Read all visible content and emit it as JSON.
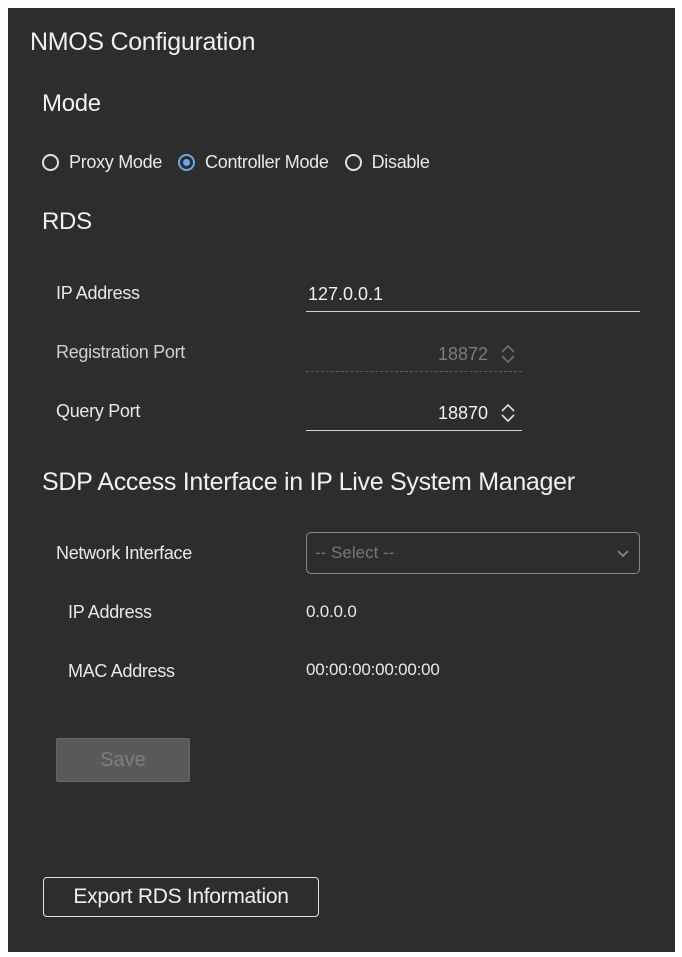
{
  "panel": {
    "title": "NMOS Configuration"
  },
  "mode": {
    "heading": "Mode",
    "options": [
      {
        "label": "Proxy Mode",
        "checked": false
      },
      {
        "label": "Controller Mode",
        "checked": true
      },
      {
        "label": "Disable",
        "checked": false
      }
    ]
  },
  "rds": {
    "heading": "RDS",
    "ip_address_label": "IP Address",
    "ip_address_value": "127.0.0.1",
    "registration_port_label": "Registration Port",
    "registration_port_value": "18872",
    "registration_port_disabled": true,
    "query_port_label": "Query Port",
    "query_port_value": "18870"
  },
  "sdp": {
    "heading": "SDP Access Interface in IP Live System Manager",
    "network_interface_label": "Network Interface",
    "network_interface_value": "-- Select --",
    "ip_address_label": "IP Address",
    "ip_address_value": "0.0.0.0",
    "mac_address_label": "MAC Address",
    "mac_address_value": "00:00:00:00:00:00"
  },
  "buttons": {
    "save_label": "Save",
    "save_disabled": true,
    "export_label": "Export RDS Information"
  },
  "icons": {
    "spin": "up-down-spinner-icon",
    "dropdown": "chevron-down-icon",
    "radio": "radio-button-icon"
  },
  "colors": {
    "panel_bg": "#2d2d2d",
    "accent_radio": "#6aa8e8",
    "disabled_text": "#7c7c7c"
  }
}
